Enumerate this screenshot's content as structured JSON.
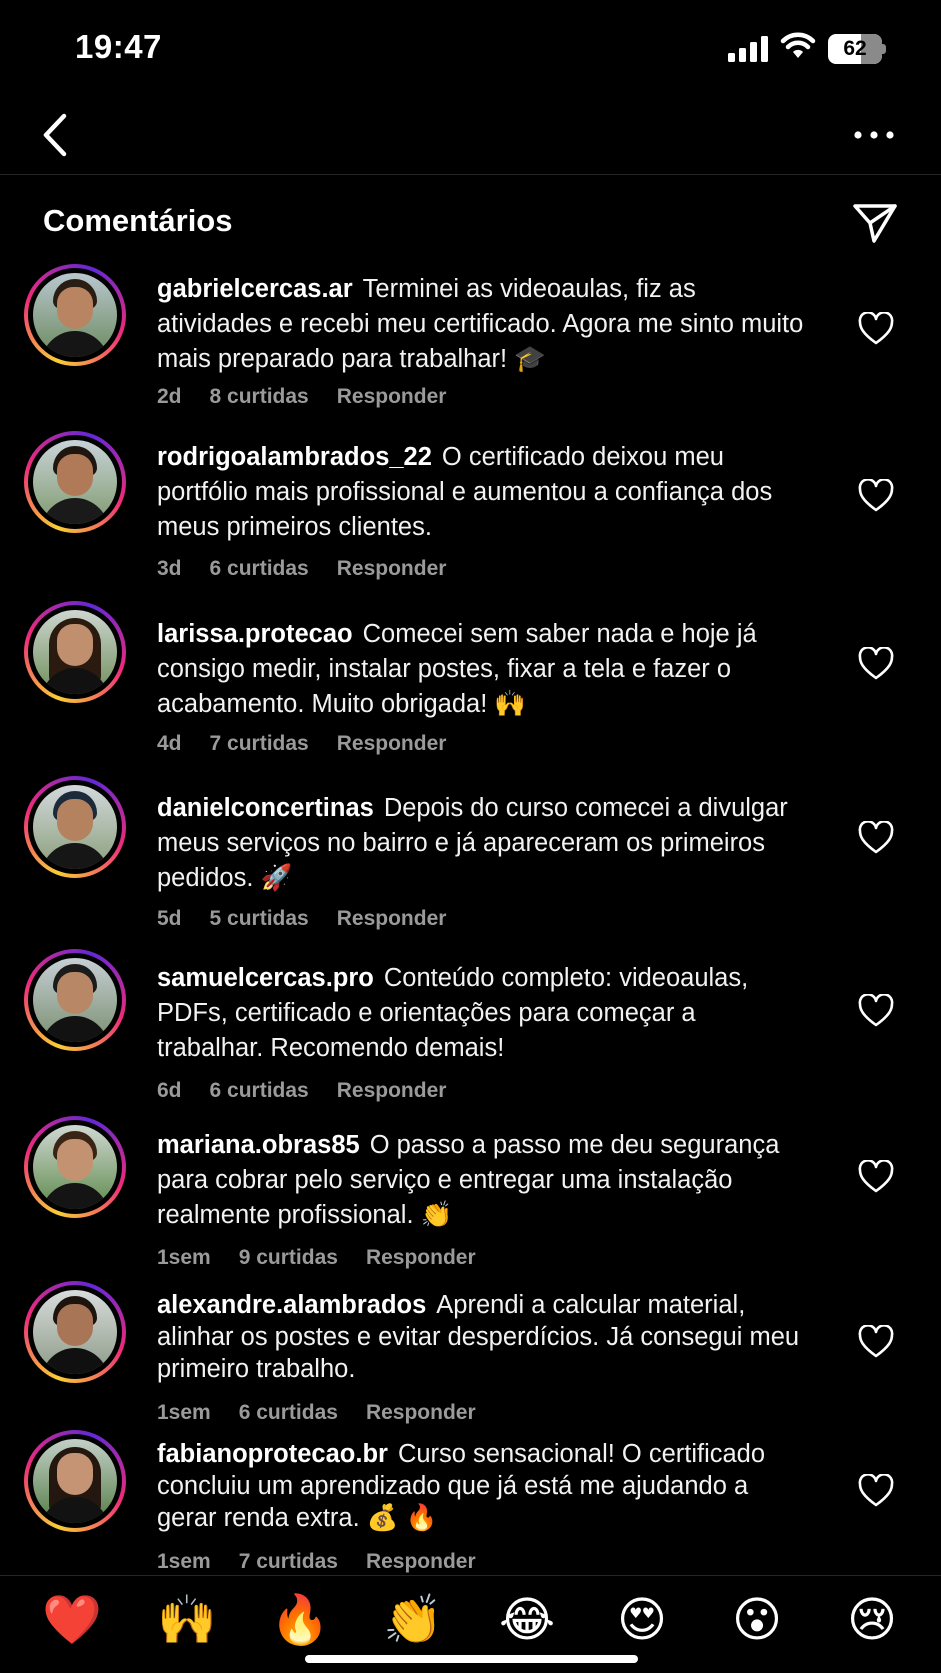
{
  "status": {
    "time": "19:47",
    "battery": "62",
    "battery_level": 0.62
  },
  "header": {
    "title": "Comentários"
  },
  "comments": [
    {
      "user": "gabrielcercas.ar",
      "text": "Terminei as videoaulas, fiz as atividades e recebi meu certificado. Agora me sinto muito mais preparado para trabalhar! 🎓",
      "time": "2d",
      "likes": "8 curtidas",
      "reply": "Responder"
    },
    {
      "user": "rodrigoalambrados_22",
      "text": "O certificado deixou meu portfólio mais profissional e aumentou a confiança dos meus primeiros clientes.",
      "time": "3d",
      "likes": "6 curtidas",
      "reply": "Responder"
    },
    {
      "user": "larissa.protecao",
      "text": "Comecei sem saber nada e hoje já consigo medir, instalar postes, fixar a tela e fazer o acabamento. Muito obrigada! 🙌",
      "time": "4d",
      "likes": "7 curtidas",
      "reply": "Responder"
    },
    {
      "user": "danielconcertinas",
      "text": "Depois do curso comecei a divulgar meus serviços no bairro e já apareceram os primeiros pedidos. 🚀",
      "time": "5d",
      "likes": "5 curtidas",
      "reply": "Responder"
    },
    {
      "user": "samuelcercas.pro",
      "text": "Conteúdo completo: videoaulas, PDFs, certificado e orientações para começar a trabalhar. Recomendo demais!",
      "time": "6d",
      "likes": "6 curtidas",
      "reply": "Responder"
    },
    {
      "user": "mariana.obras85",
      "text": "O passo a passo me deu segurança para cobrar pelo serviço e entregar uma instalação realmente profissional. 👏",
      "time": "1sem",
      "likes": "9 curtidas",
      "reply": "Responder"
    },
    {
      "user": "alexandre.alambrados",
      "text": "Aprendi a calcular material, alinhar os postes e evitar desperdícios. Já consegui meu primeiro trabalho.",
      "time": "1sem",
      "likes": "6 curtidas",
      "reply": "Responder"
    },
    {
      "user": "fabianoprotecao.br",
      "text": "Curso sensacional! O certificado concluiu um aprendizado que já está me ajudando a gerar renda extra. 💰 🔥",
      "time": "1sem",
      "likes": "7 curtidas",
      "reply": "Responder"
    }
  ],
  "reactions": [
    "❤️",
    "🙌",
    "🔥",
    "👏",
    "😂",
    "😍",
    "😮",
    "😢"
  ],
  "colors": {
    "background": "#000000",
    "meta_text": "#9a9a9a",
    "divider": "#262626"
  }
}
